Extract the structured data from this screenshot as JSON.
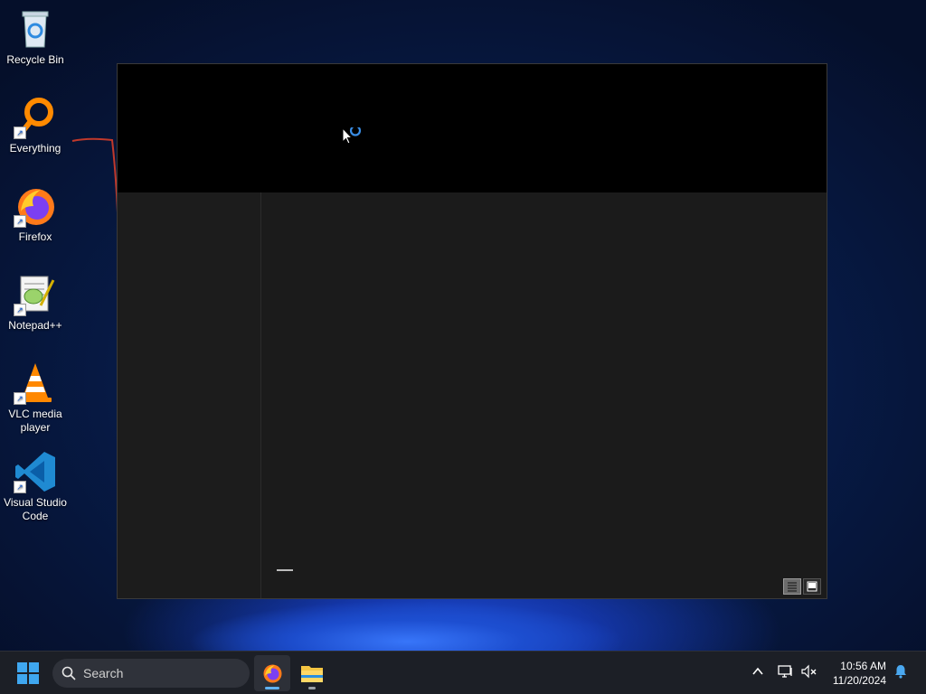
{
  "desktop": {
    "icons": [
      {
        "label": "Recycle Bin",
        "icon": "recycle-bin-icon"
      },
      {
        "label": "Everything",
        "icon": "everything-search-icon"
      },
      {
        "label": "Firefox",
        "icon": "firefox-icon"
      },
      {
        "label": "Notepad++",
        "icon": "notepad-plus-plus-icon"
      },
      {
        "label": "VLC media player",
        "icon": "vlc-icon"
      },
      {
        "label": "Visual Studio Code",
        "icon": "vscode-icon"
      }
    ]
  },
  "window": {
    "state": "loading",
    "view_buttons": [
      "details-view",
      "preview-view"
    ]
  },
  "taskbar": {
    "search_label": "Search",
    "apps": [
      {
        "name": "Firefox",
        "icon": "firefox-icon",
        "active": true
      },
      {
        "name": "File Explorer",
        "icon": "file-explorer-icon",
        "active": false
      }
    ],
    "time": "10:56 AM",
    "date": "11/20/2024"
  },
  "colors": {
    "accent": "#5fb2f2",
    "taskbar_bg": "#1c1f26",
    "window_header_bg": "#000000",
    "window_body_bg": "#1b1b1b"
  }
}
